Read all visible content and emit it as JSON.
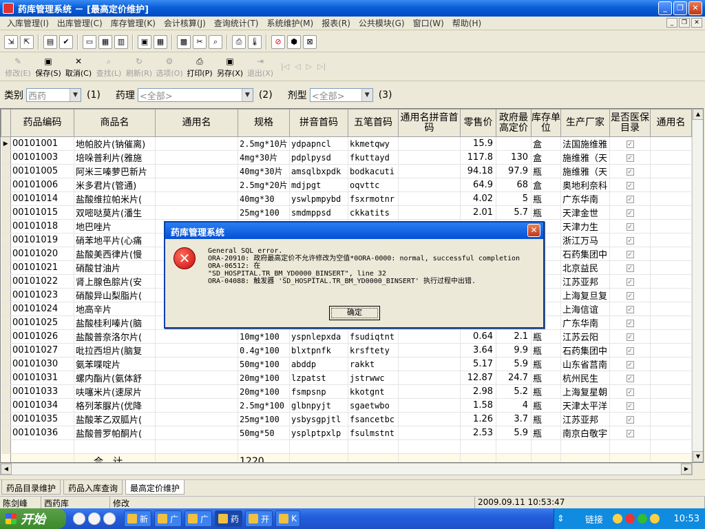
{
  "window": {
    "title": "药库管理系统 － [最高定价维护]"
  },
  "menu": [
    "入库管理(I)",
    "出库管理(C)",
    "库存管理(K)",
    "会计核算(J)",
    "查询统计(T)",
    "系统维护(M)",
    "报表(R)",
    "公共模块(G)",
    "窗口(W)",
    "帮助(H)"
  ],
  "actions": {
    "modify": "修改(E)",
    "save": "保存(S)",
    "cancel": "取消(C)",
    "find": "查找(L)",
    "refresh": "刷新(R)",
    "options": "选项(O)",
    "print": "打印(P)",
    "saveas": "另存(X)",
    "exit": "退出(X)"
  },
  "filters": {
    "category_label": "类别",
    "category_value": "西药",
    "category_num": "(1)",
    "pharmacology_label": "药理",
    "pharmacology_value": "<全部>",
    "pharmacology_num": "(2)",
    "form_label": "剂型",
    "form_value": "<全部>",
    "form_num": "(3)"
  },
  "table": {
    "columns": [
      "药品编码",
      "商品名",
      "通用名",
      "规格",
      "拼音首码",
      "五笔首码",
      "通用名拼音首码",
      "零售价",
      "政府最高定价",
      "库存单位",
      "生产厂家",
      "是否医保目录",
      "通用名"
    ],
    "rows": [
      [
        "00101001",
        "地帕胶片(钠催离)",
        "",
        "2.5mg*10片",
        "ydpapncl",
        "kkmetqwy",
        "",
        "15.9",
        "",
        "盒",
        "法国施维雅"
      ],
      [
        "00101003",
        "培哚普利片(雅施",
        "",
        "4mg*30片",
        "pdplpysd",
        "fkuttayd",
        "",
        "117.8",
        "130",
        "盒",
        "施维雅（天"
      ],
      [
        "00101005",
        "阿米三嗪萝巴新片",
        "",
        "40mg*30片",
        "amsqlbxpdk",
        "bodkacuti",
        "",
        "94.18",
        "97.9",
        "瓶",
        "施维雅（天"
      ],
      [
        "00101006",
        "米多君片(管通)",
        "",
        "2.5mg*20片",
        "mdjpgt",
        "oqvttc",
        "",
        "64.9",
        "68",
        "盒",
        "奥地利奈科"
      ],
      [
        "00101014",
        "盐酸维拉帕米片(",
        "",
        "40mg*30",
        "yswlpmpybd",
        "fsxrmotnr",
        "",
        "4.02",
        "5",
        "瓶",
        "广东华南"
      ],
      [
        "00101015",
        "双嘧哒莫片(潘生",
        "",
        "25mg*100",
        "smdmppsd",
        "ckkatits",
        "",
        "2.01",
        "5.7",
        "瓶",
        "天津金世"
      ],
      [
        "00101018",
        "地巴唑片",
        "",
        "",
        "",
        "",
        "",
        "",
        "",
        "",
        "天津力生"
      ],
      [
        "00101019",
        "硝苯地平片(心痛",
        "",
        "",
        "",
        "",
        "",
        "",
        "",
        "",
        "浙江万马"
      ],
      [
        "00101020",
        "盐酸美西律片(慢",
        "",
        "",
        "",
        "",
        "",
        "",
        "",
        "",
        "石药集团中"
      ],
      [
        "00101021",
        "硝酸甘油片",
        "",
        "",
        "",
        "",
        "",
        "",
        "",
        "",
        "北京益民"
      ],
      [
        "00101022",
        "肾上腺色腙片(安",
        "",
        "",
        "",
        "",
        "",
        "",
        "",
        "",
        "江苏亚邦"
      ],
      [
        "00101023",
        "硝酸异山梨脂片(",
        "",
        "",
        "",
        "",
        "",
        "",
        "",
        "",
        "上海复旦复"
      ],
      [
        "00101024",
        "地高辛片",
        "",
        "",
        "",
        "",
        "",
        "",
        "",
        "",
        "上海信谊"
      ],
      [
        "00101025",
        "盐酸桂利嗪片(脑",
        "",
        "",
        "",
        "",
        "",
        "",
        "",
        "",
        "广东华南"
      ],
      [
        "00101026",
        "盐酸普奈洛尔片(",
        "",
        "10mg*100",
        "yspnlepxda",
        "fsudiqtnt",
        "",
        "0.64",
        "2.1",
        "瓶",
        "江苏云阳"
      ],
      [
        "00101027",
        "吡拉西坦片(脑复",
        "",
        "0.4g*100",
        "blxtpnfk",
        "krsftety",
        "",
        "3.64",
        "9.9",
        "瓶",
        "石药集团中"
      ],
      [
        "00101030",
        "氨苯喋啶片",
        "",
        "50mg*100",
        "abddp",
        "rakkt",
        "",
        "5.17",
        "5.9",
        "瓶",
        "山东省莒南"
      ],
      [
        "00101031",
        "螺内酯片(氨体舒",
        "",
        "20mg*100",
        "lzpatst",
        "jstrwwc",
        "",
        "12.87",
        "24.7",
        "瓶",
        "杭州民生"
      ],
      [
        "00101033",
        "呋噻米片(速尿片",
        "",
        "20mg*100",
        "fsmpsnp",
        "kkotgnt",
        "",
        "2.98",
        "5.2",
        "瓶",
        "上海复星朝"
      ],
      [
        "00101034",
        "格列苯脲片(优降",
        "",
        "2.5mg*100",
        "glbnpyjt",
        "sgaetwbo",
        "",
        "1.58",
        "4",
        "瓶",
        "天津太平洋"
      ],
      [
        "00101035",
        "盐酸苯乙双胍片(",
        "",
        "25mg*100",
        "ysbysgpjtl",
        "fsancetbc",
        "",
        "1.26",
        "3.7",
        "瓶",
        "江苏亚邦"
      ],
      [
        "00101036",
        "盐酸普罗帕酮片(",
        "",
        "50mg*50",
        "ysplptpxlp",
        "fsulmstnt",
        "",
        "2.53",
        "5.9",
        "瓶",
        "南京白敬宇"
      ]
    ],
    "total_label": "合　计",
    "total_value": "1220"
  },
  "tabs": [
    "药品目录维护",
    "药品入库查询",
    "最高定价维护"
  ],
  "status": {
    "user": "陈剑峰",
    "dept": "西药库",
    "mode": "修改",
    "datetime": "2009.09.11 10:53:47"
  },
  "dialog": {
    "title": "药库管理系统",
    "message": "General SQL error.\nORA-20910: 政府最高定价不允许修改为空值*0ORA-0000: normal, successful completion\nORA-06512: 在\n\"SD_HOSPITAL.TR_BM_YD0000_BINSERT\", line 32\nORA-04088: 触发器 'SD_HOSPITAL.TR_BM_YD0000_BINSERT' 执行过程中出错.",
    "ok_label": "确定"
  },
  "taskbar": {
    "start_label": "开始",
    "items": [
      "新",
      "广",
      "广",
      "药",
      "开",
      "K"
    ],
    "links_label": "链接",
    "clock": "10:53"
  },
  "colors": {
    "titlebar": "#0a5fd8",
    "dialog_title": "#0450d8",
    "error_red": "#c80c0c",
    "total_row": "#fffae8"
  }
}
